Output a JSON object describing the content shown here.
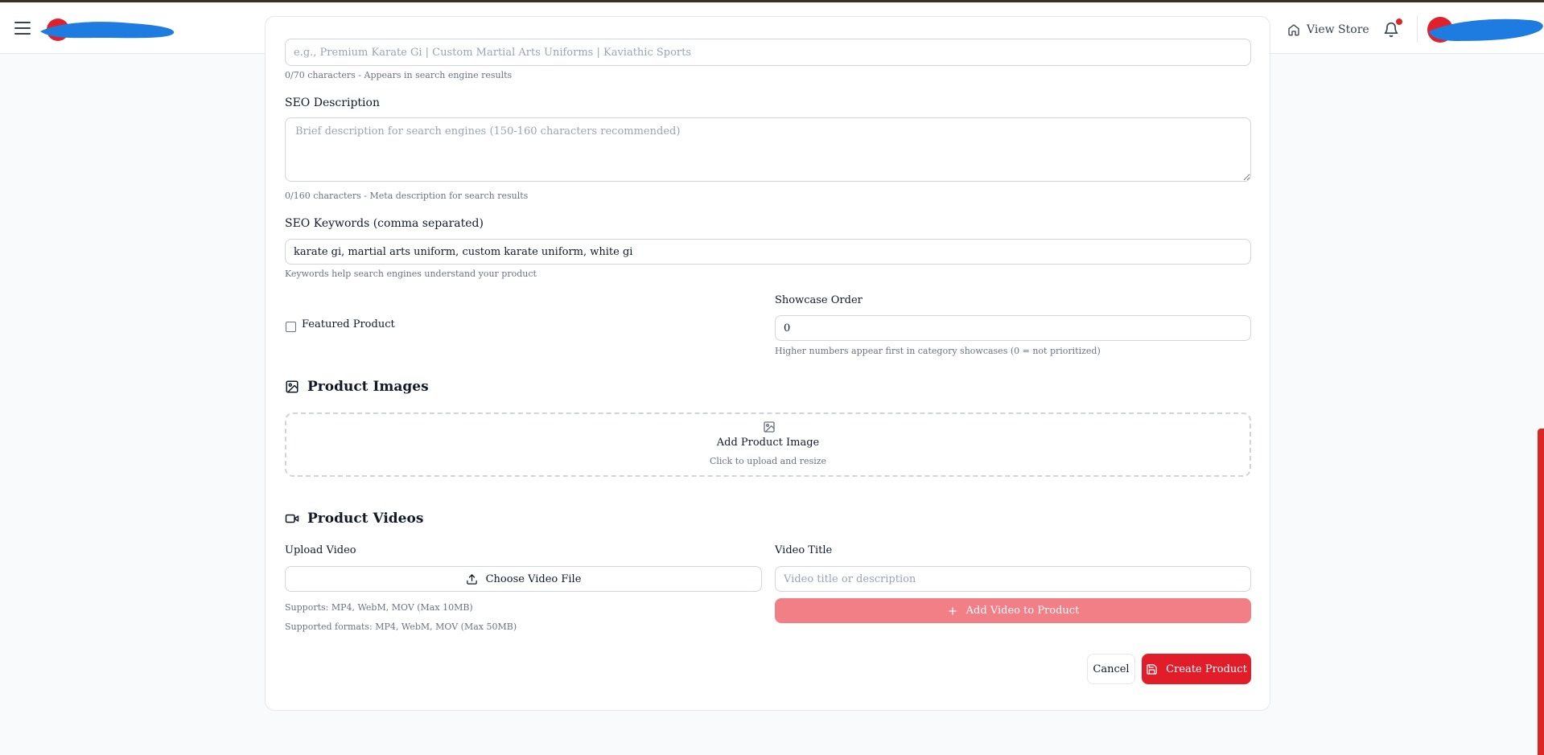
{
  "header": {
    "view_store_label": "View Store"
  },
  "icons": {
    "menu": "hamburger-icon",
    "home": "home-icon",
    "bell": "bell-icon",
    "image": "image-icon",
    "video": "video-icon",
    "upload": "upload-icon",
    "plus": "plus-icon",
    "save": "save-icon"
  },
  "form": {
    "seo_title_placeholder": "e.g., Premium Karate Gi | Custom Martial Arts Uniforms | Kaviathic Sports",
    "seo_title_hint": "0/70 characters - Appears in search engine results",
    "seo_description_label": "SEO Description",
    "seo_description_placeholder": "Brief description for search engines (150-160 characters recommended)",
    "seo_description_hint": "0/160 characters - Meta description for search results",
    "seo_keywords_label": "SEO Keywords (comma separated)",
    "seo_keywords_value": "karate gi, martial arts uniform, custom karate uniform, white gi",
    "seo_keywords_hint": "Keywords help search engines understand your product",
    "featured_label": "Featured Product",
    "showcase_label": "Showcase Order",
    "showcase_value": "0",
    "showcase_hint": "Higher numbers appear first in category showcases (0 = not prioritized)"
  },
  "images": {
    "title": "Product Images",
    "add_label": "Add Product Image",
    "add_hint": "Click to upload and resize"
  },
  "videos": {
    "title": "Product Videos",
    "upload_label": "Upload Video",
    "choose_button": "Choose Video File",
    "supports_hint": "Supports: MP4, WebM, MOV (Max 10MB)",
    "formats_hint": "Supported formats: MP4, WebM, MOV (Max 50MB)",
    "video_title_label": "Video Title",
    "video_title_placeholder": "Video title or description",
    "add_video_button": "Add Video to Product"
  },
  "actions": {
    "cancel": "Cancel",
    "create": "Create Product"
  },
  "colors": {
    "accent": "#dc2626",
    "accent_disabled": "#f27f86",
    "border": "#d1d5db",
    "muted_text": "#6b7280"
  }
}
